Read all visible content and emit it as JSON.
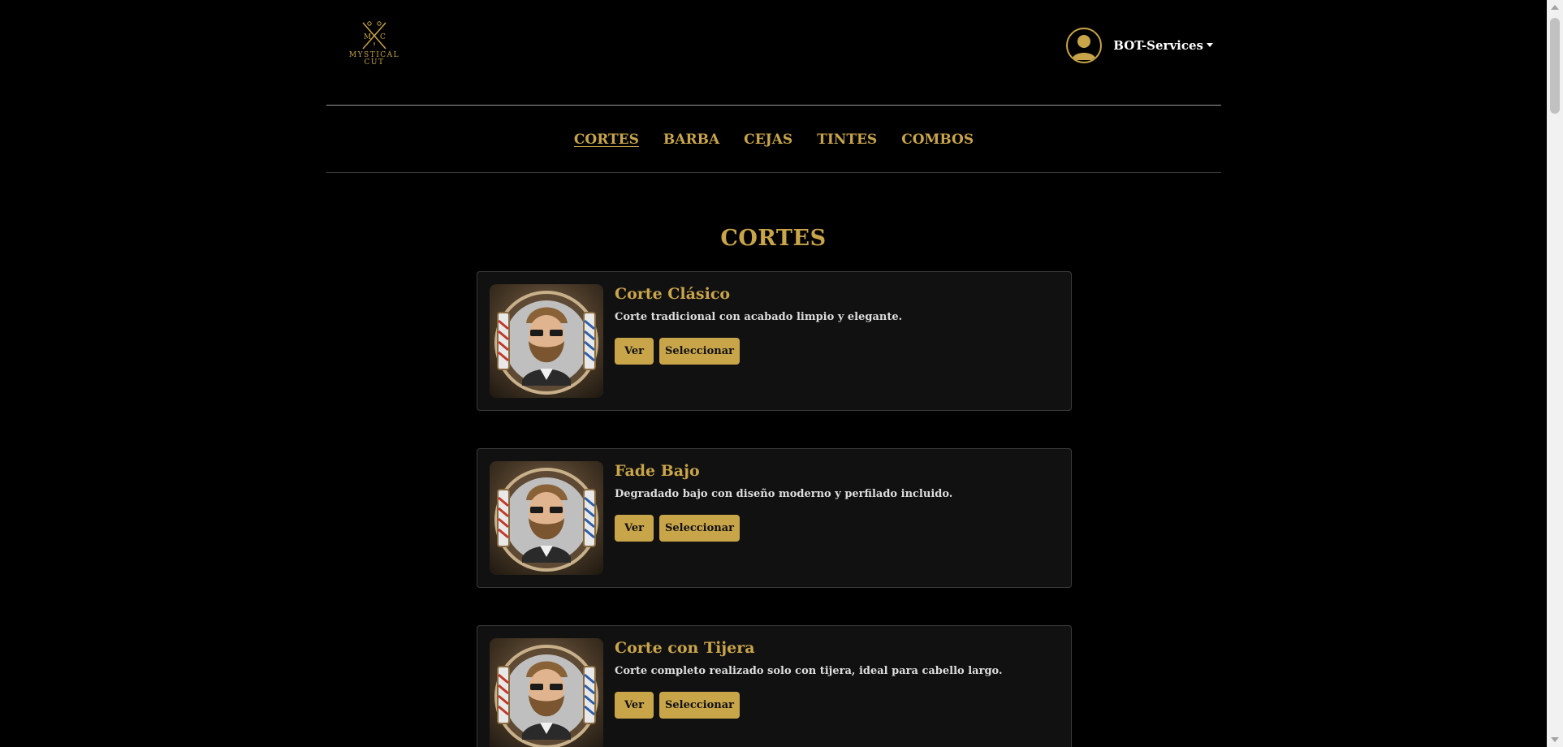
{
  "header": {
    "logo": {
      "initial_left": "M",
      "initial_right": "C",
      "line1": "MYSTICAL",
      "line2": "CUT"
    },
    "user": {
      "name": "BOT-Services",
      "icon": "user-avatar-icon"
    }
  },
  "nav": {
    "items": [
      {
        "label": "CORTES",
        "active": true
      },
      {
        "label": "BARBA",
        "active": false
      },
      {
        "label": "CEJAS",
        "active": false
      },
      {
        "label": "TINTES",
        "active": false
      },
      {
        "label": "COMBOS",
        "active": false
      }
    ]
  },
  "section": {
    "title": "CORTES"
  },
  "services": [
    {
      "name": "Corte Clásico",
      "description": "Corte tradicional con acabado limpio y elegante.",
      "view_label": "Ver",
      "select_label": "Seleccionar",
      "image_icon": "barber-portrait-icon"
    },
    {
      "name": "Fade Bajo",
      "description": "Degradado bajo con diseño moderno y perfilado incluido.",
      "view_label": "Ver",
      "select_label": "Seleccionar",
      "image_icon": "barber-portrait-icon"
    },
    {
      "name": "Corte con Tijera",
      "description": "Corte completo realizado solo con tijera, ideal para cabello largo.",
      "view_label": "Ver",
      "select_label": "Seleccionar",
      "image_icon": "barber-portrait-icon"
    }
  ],
  "colors": {
    "background": "#000000",
    "accent": "#c9a54a",
    "card": "#111111",
    "text_light": "#dddddd"
  }
}
